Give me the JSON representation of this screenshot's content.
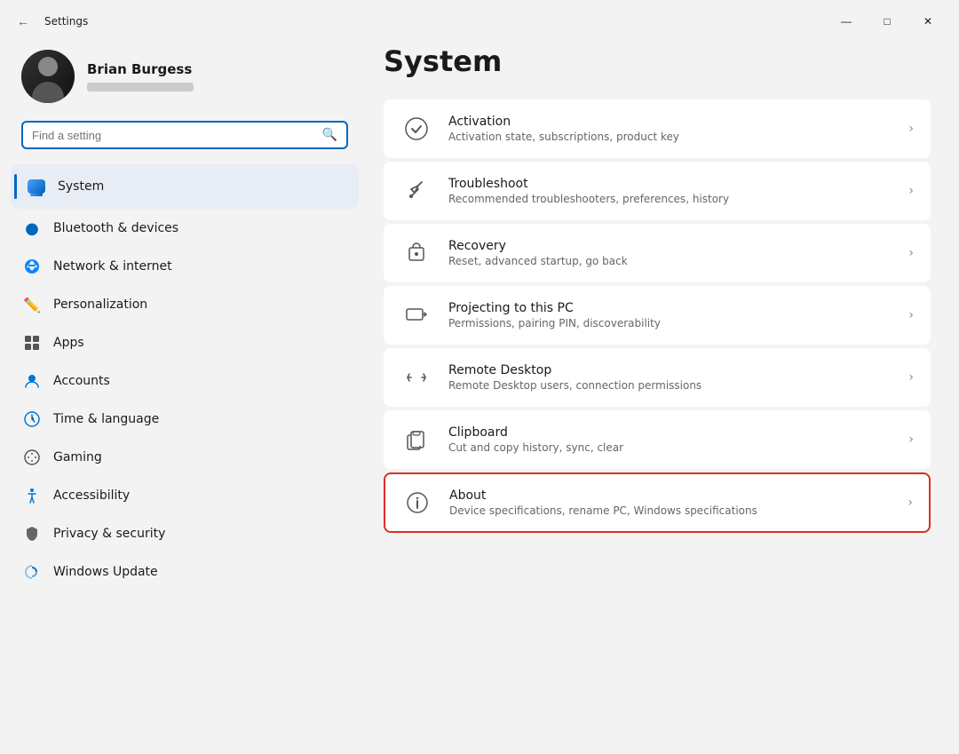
{
  "window": {
    "title": "Settings",
    "controls": {
      "minimize": "—",
      "maximize": "□",
      "close": "✕"
    }
  },
  "user": {
    "name": "Brian Burgess"
  },
  "search": {
    "placeholder": "Find a setting"
  },
  "nav": {
    "items": [
      {
        "id": "system",
        "label": "System",
        "icon": "💻",
        "active": true
      },
      {
        "id": "bluetooth",
        "label": "Bluetooth & devices",
        "icon": "🔵",
        "active": false
      },
      {
        "id": "network",
        "label": "Network & internet",
        "icon": "🌐",
        "active": false
      },
      {
        "id": "personalization",
        "label": "Personalization",
        "icon": "✏️",
        "active": false
      },
      {
        "id": "apps",
        "label": "Apps",
        "icon": "📦",
        "active": false
      },
      {
        "id": "accounts",
        "label": "Accounts",
        "icon": "👤",
        "active": false
      },
      {
        "id": "time",
        "label": "Time & language",
        "icon": "🕐",
        "active": false
      },
      {
        "id": "gaming",
        "label": "Gaming",
        "icon": "🎮",
        "active": false
      },
      {
        "id": "accessibility",
        "label": "Accessibility",
        "icon": "♿",
        "active": false
      },
      {
        "id": "privacy",
        "label": "Privacy & security",
        "icon": "🛡️",
        "active": false
      },
      {
        "id": "update",
        "label": "Windows Update",
        "icon": "🔄",
        "active": false
      }
    ]
  },
  "main": {
    "title": "System",
    "settings": [
      {
        "id": "activation",
        "icon": "✅",
        "title": "Activation",
        "desc": "Activation state, subscriptions, product key",
        "highlighted": false
      },
      {
        "id": "troubleshoot",
        "icon": "🔧",
        "title": "Troubleshoot",
        "desc": "Recommended troubleshooters, preferences, history",
        "highlighted": false
      },
      {
        "id": "recovery",
        "icon": "💾",
        "title": "Recovery",
        "desc": "Reset, advanced startup, go back",
        "highlighted": false
      },
      {
        "id": "projecting",
        "icon": "🖥️",
        "title": "Projecting to this PC",
        "desc": "Permissions, pairing PIN, discoverability",
        "highlighted": false
      },
      {
        "id": "remote-desktop",
        "icon": "⇌",
        "title": "Remote Desktop",
        "desc": "Remote Desktop users, connection permissions",
        "highlighted": false
      },
      {
        "id": "clipboard",
        "icon": "📋",
        "title": "Clipboard",
        "desc": "Cut and copy history, sync, clear",
        "highlighted": false
      },
      {
        "id": "about",
        "icon": "ℹ️",
        "title": "About",
        "desc": "Device specifications, rename PC, Windows specifications",
        "highlighted": true
      }
    ]
  }
}
